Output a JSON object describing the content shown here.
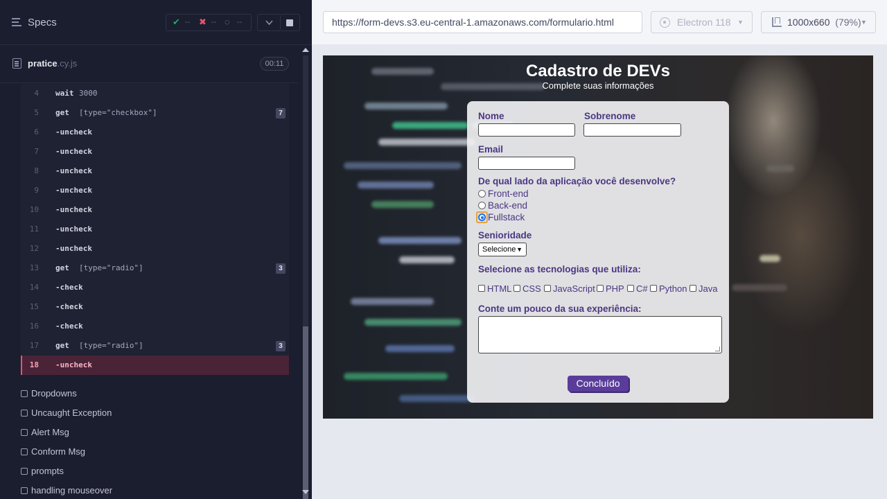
{
  "reporter": {
    "header": {
      "title": "Specs",
      "passed": "--",
      "failed": "--",
      "pending": "--"
    },
    "spec_file": {
      "name": "pratice",
      "ext": ".cy.js",
      "duration": "00:11"
    },
    "commands": [
      {
        "num": "4",
        "name": "wait",
        "message": "3000",
        "badge": ""
      },
      {
        "num": "5",
        "name": "get",
        "message": "[type=\"checkbox\"]",
        "badge": "7"
      },
      {
        "num": "6",
        "name": "-uncheck",
        "message": "",
        "badge": ""
      },
      {
        "num": "7",
        "name": "-uncheck",
        "message": "",
        "badge": ""
      },
      {
        "num": "8",
        "name": "-uncheck",
        "message": "",
        "badge": ""
      },
      {
        "num": "9",
        "name": "-uncheck",
        "message": "",
        "badge": ""
      },
      {
        "num": "10",
        "name": "-uncheck",
        "message": "",
        "badge": ""
      },
      {
        "num": "11",
        "name": "-uncheck",
        "message": "",
        "badge": ""
      },
      {
        "num": "12",
        "name": "-uncheck",
        "message": "",
        "badge": ""
      },
      {
        "num": "13",
        "name": "get",
        "message": "[type=\"radio\"]",
        "badge": "3"
      },
      {
        "num": "14",
        "name": "-check",
        "message": "",
        "badge": ""
      },
      {
        "num": "15",
        "name": "-check",
        "message": "",
        "badge": ""
      },
      {
        "num": "16",
        "name": "-check",
        "message": "",
        "badge": ""
      },
      {
        "num": "17",
        "name": "get",
        "message": "[type=\"radio\"]",
        "badge": "3"
      },
      {
        "num": "18",
        "name": "-uncheck",
        "message": "",
        "badge": ""
      }
    ],
    "tests": [
      "Dropdowns",
      "Uncaught Exception",
      "Alert Msg",
      "Conform Msg",
      "prompts",
      "handling mouseover"
    ]
  },
  "aut_header": {
    "url": "https://form-devs.s3.eu-central-1.amazonaws.com/formulario.html",
    "browser": "Electron 118",
    "viewport": "1000x660",
    "zoom": "(79%)"
  },
  "app": {
    "title": "Cadastro de DEVs",
    "subtitle": "Complete suas informações",
    "form": {
      "nome_label": "Nome",
      "sobrenome_label": "Sobrenome",
      "email_label": "Email",
      "side_question": "De qual lado da aplicação você desenvolve?",
      "radios": [
        "Front-end",
        "Back-end",
        "Fullstack"
      ],
      "selected_radio": "Fullstack",
      "seniority_label": "Senioridade",
      "seniority_value": "Selecione",
      "tech_label": "Selecione as tecnologias que utiliza:",
      "techs": [
        "HTML",
        "CSS",
        "JavaScript",
        "PHP",
        "C#",
        "Python",
        "Java"
      ],
      "experience_label": "Conte um pouco da sua experiência:",
      "submit": "Concluído"
    }
  },
  "colors": {
    "reporter_bg": "#1b1e2e",
    "active_command": "#4a2337",
    "form_text": "#4b3682",
    "submit_bg": "#5a3d9a"
  }
}
